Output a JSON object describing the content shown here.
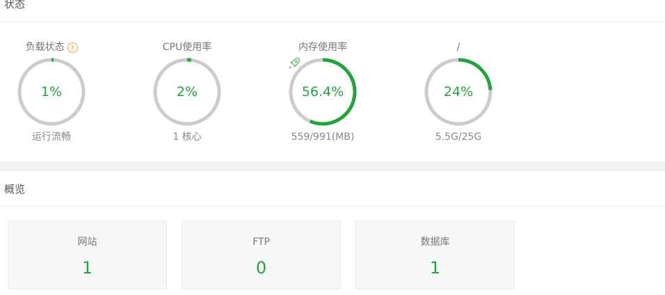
{
  "status": {
    "title": "状态",
    "gauges": [
      {
        "label": "负载状态",
        "help_icon": "?",
        "value": "1%",
        "sub": "运行流畅",
        "percent": 1
      },
      {
        "label": "CPU使用率",
        "value": "2%",
        "sub": "1 核心",
        "percent": 2
      },
      {
        "label": "内存使用率",
        "value": "56.4%",
        "sub": "559/991(MB)",
        "percent": 56.4,
        "icon": "rocket-icon"
      },
      {
        "label": "/",
        "value": "24%",
        "sub": "5.5G/25G",
        "percent": 24
      }
    ],
    "colors": {
      "track": "#cccccc",
      "fill": "#20a53a",
      "help": "#f0a030"
    }
  },
  "overview": {
    "title": "概览",
    "cards": [
      {
        "label": "网站",
        "value": "1"
      },
      {
        "label": "FTP",
        "value": "0"
      },
      {
        "label": "数据库",
        "value": "1"
      }
    ]
  }
}
